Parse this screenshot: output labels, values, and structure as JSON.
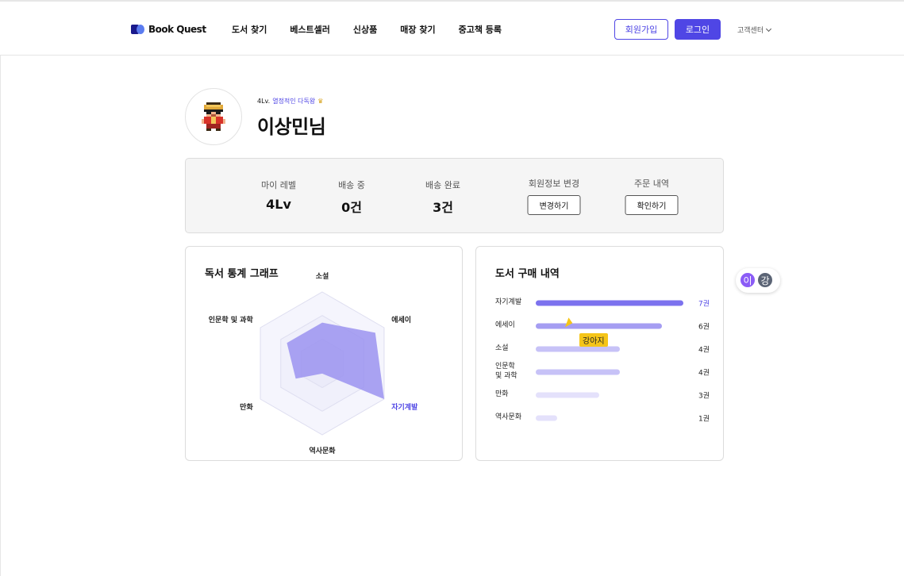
{
  "brand": {
    "name": "Book Quest"
  },
  "nav": {
    "items": [
      {
        "label": "도서 찾기"
      },
      {
        "label": "베스트셀러"
      },
      {
        "label": "신상품"
      },
      {
        "label": "매장 찾기"
      },
      {
        "label": "중고책 등록"
      }
    ],
    "signup_label": "회원가입",
    "login_label": "로그인",
    "support_label": "고객센터"
  },
  "profile": {
    "level_prefix": "4Lv.",
    "level_title": "열정적인 다독왕",
    "name": "이상민님"
  },
  "stats": {
    "my_level": {
      "label": "마이 레벨",
      "value": "4Lv"
    },
    "shipping": {
      "label": "배송 중",
      "value": "0건"
    },
    "delivered": {
      "label": "배송 완료",
      "value": "3건"
    },
    "edit_info": {
      "label": "회원정보 변경",
      "button": "변경하기"
    },
    "orders": {
      "label": "주문 내역",
      "button": "확인하기"
    }
  },
  "radar": {
    "title": "독서 통계 그래프",
    "labels": [
      "소설",
      "에세이",
      "자기계발",
      "역사문화",
      "만화",
      "인문학 및 과학"
    ],
    "highlight": "자기계발"
  },
  "purchase": {
    "title": "도서 구매 내역",
    "rows": [
      {
        "label": "자기계발",
        "count": "7권",
        "value": 7,
        "highlight": true
      },
      {
        "label": "에세이",
        "count": "6권",
        "value": 6
      },
      {
        "label": "소설",
        "count": "4권",
        "value": 4
      },
      {
        "label_line1": "인문학",
        "label_line2": "및 과학",
        "count": "4권",
        "value": 4
      },
      {
        "label": "만화",
        "count": "3권",
        "value": 3
      },
      {
        "label": "역사문화",
        "count": "1권",
        "value": 1
      }
    ]
  },
  "chart_data": [
    {
      "type": "radar",
      "title": "독서 통계 그래프",
      "categories": [
        "소설",
        "에세이",
        "자기계발",
        "역사문화",
        "만화",
        "인문학 및 과학"
      ],
      "values": [
        4,
        6,
        7,
        1,
        3,
        4
      ],
      "max": 7
    },
    {
      "type": "bar",
      "title": "도서 구매 내역",
      "categories": [
        "자기계발",
        "에세이",
        "소설",
        "인문학 및 과학",
        "만화",
        "역사문화"
      ],
      "values": [
        7,
        6,
        4,
        4,
        3,
        1
      ]
    }
  ],
  "cursor": {
    "label": "강아지"
  },
  "presence": {
    "users": [
      "이",
      "강"
    ]
  },
  "colors": {
    "accent": "#4f46e5",
    "radar_fill": "#9b93f0",
    "bar_strong": "#7c72ee",
    "bar_medium": "#a59df2",
    "bar_light": "#c7c2f7",
    "bar_faint": "#e4e1fb"
  }
}
